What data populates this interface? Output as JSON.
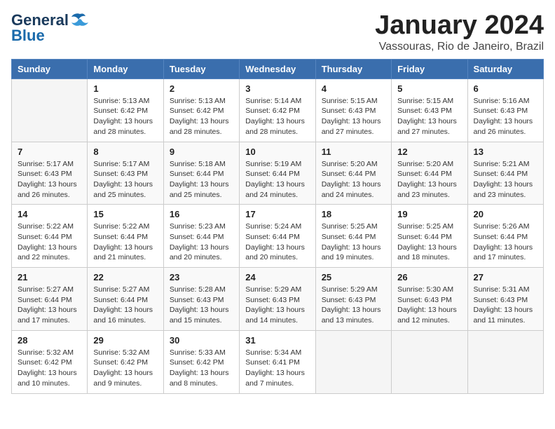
{
  "logo": {
    "text_general": "General",
    "text_blue": "Blue"
  },
  "title": "January 2024",
  "subtitle": "Vassouras, Rio de Janeiro, Brazil",
  "weekdays": [
    "Sunday",
    "Monday",
    "Tuesday",
    "Wednesday",
    "Thursday",
    "Friday",
    "Saturday"
  ],
  "weeks": [
    [
      {
        "day": "",
        "info": ""
      },
      {
        "day": "1",
        "info": "Sunrise: 5:13 AM\nSunset: 6:42 PM\nDaylight: 13 hours\nand 28 minutes."
      },
      {
        "day": "2",
        "info": "Sunrise: 5:13 AM\nSunset: 6:42 PM\nDaylight: 13 hours\nand 28 minutes."
      },
      {
        "day": "3",
        "info": "Sunrise: 5:14 AM\nSunset: 6:42 PM\nDaylight: 13 hours\nand 28 minutes."
      },
      {
        "day": "4",
        "info": "Sunrise: 5:15 AM\nSunset: 6:43 PM\nDaylight: 13 hours\nand 27 minutes."
      },
      {
        "day": "5",
        "info": "Sunrise: 5:15 AM\nSunset: 6:43 PM\nDaylight: 13 hours\nand 27 minutes."
      },
      {
        "day": "6",
        "info": "Sunrise: 5:16 AM\nSunset: 6:43 PM\nDaylight: 13 hours\nand 26 minutes."
      }
    ],
    [
      {
        "day": "7",
        "info": "Sunrise: 5:17 AM\nSunset: 6:43 PM\nDaylight: 13 hours\nand 26 minutes."
      },
      {
        "day": "8",
        "info": "Sunrise: 5:17 AM\nSunset: 6:43 PM\nDaylight: 13 hours\nand 25 minutes."
      },
      {
        "day": "9",
        "info": "Sunrise: 5:18 AM\nSunset: 6:44 PM\nDaylight: 13 hours\nand 25 minutes."
      },
      {
        "day": "10",
        "info": "Sunrise: 5:19 AM\nSunset: 6:44 PM\nDaylight: 13 hours\nand 24 minutes."
      },
      {
        "day": "11",
        "info": "Sunrise: 5:20 AM\nSunset: 6:44 PM\nDaylight: 13 hours\nand 24 minutes."
      },
      {
        "day": "12",
        "info": "Sunrise: 5:20 AM\nSunset: 6:44 PM\nDaylight: 13 hours\nand 23 minutes."
      },
      {
        "day": "13",
        "info": "Sunrise: 5:21 AM\nSunset: 6:44 PM\nDaylight: 13 hours\nand 23 minutes."
      }
    ],
    [
      {
        "day": "14",
        "info": "Sunrise: 5:22 AM\nSunset: 6:44 PM\nDaylight: 13 hours\nand 22 minutes."
      },
      {
        "day": "15",
        "info": "Sunrise: 5:22 AM\nSunset: 6:44 PM\nDaylight: 13 hours\nand 21 minutes."
      },
      {
        "day": "16",
        "info": "Sunrise: 5:23 AM\nSunset: 6:44 PM\nDaylight: 13 hours\nand 20 minutes."
      },
      {
        "day": "17",
        "info": "Sunrise: 5:24 AM\nSunset: 6:44 PM\nDaylight: 13 hours\nand 20 minutes."
      },
      {
        "day": "18",
        "info": "Sunrise: 5:25 AM\nSunset: 6:44 PM\nDaylight: 13 hours\nand 19 minutes."
      },
      {
        "day": "19",
        "info": "Sunrise: 5:25 AM\nSunset: 6:44 PM\nDaylight: 13 hours\nand 18 minutes."
      },
      {
        "day": "20",
        "info": "Sunrise: 5:26 AM\nSunset: 6:44 PM\nDaylight: 13 hours\nand 17 minutes."
      }
    ],
    [
      {
        "day": "21",
        "info": "Sunrise: 5:27 AM\nSunset: 6:44 PM\nDaylight: 13 hours\nand 17 minutes."
      },
      {
        "day": "22",
        "info": "Sunrise: 5:27 AM\nSunset: 6:44 PM\nDaylight: 13 hours\nand 16 minutes."
      },
      {
        "day": "23",
        "info": "Sunrise: 5:28 AM\nSunset: 6:43 PM\nDaylight: 13 hours\nand 15 minutes."
      },
      {
        "day": "24",
        "info": "Sunrise: 5:29 AM\nSunset: 6:43 PM\nDaylight: 13 hours\nand 14 minutes."
      },
      {
        "day": "25",
        "info": "Sunrise: 5:29 AM\nSunset: 6:43 PM\nDaylight: 13 hours\nand 13 minutes."
      },
      {
        "day": "26",
        "info": "Sunrise: 5:30 AM\nSunset: 6:43 PM\nDaylight: 13 hours\nand 12 minutes."
      },
      {
        "day": "27",
        "info": "Sunrise: 5:31 AM\nSunset: 6:43 PM\nDaylight: 13 hours\nand 11 minutes."
      }
    ],
    [
      {
        "day": "28",
        "info": "Sunrise: 5:32 AM\nSunset: 6:42 PM\nDaylight: 13 hours\nand 10 minutes."
      },
      {
        "day": "29",
        "info": "Sunrise: 5:32 AM\nSunset: 6:42 PM\nDaylight: 13 hours\nand 9 minutes."
      },
      {
        "day": "30",
        "info": "Sunrise: 5:33 AM\nSunset: 6:42 PM\nDaylight: 13 hours\nand 8 minutes."
      },
      {
        "day": "31",
        "info": "Sunrise: 5:34 AM\nSunset: 6:41 PM\nDaylight: 13 hours\nand 7 minutes."
      },
      {
        "day": "",
        "info": ""
      },
      {
        "day": "",
        "info": ""
      },
      {
        "day": "",
        "info": ""
      }
    ]
  ]
}
